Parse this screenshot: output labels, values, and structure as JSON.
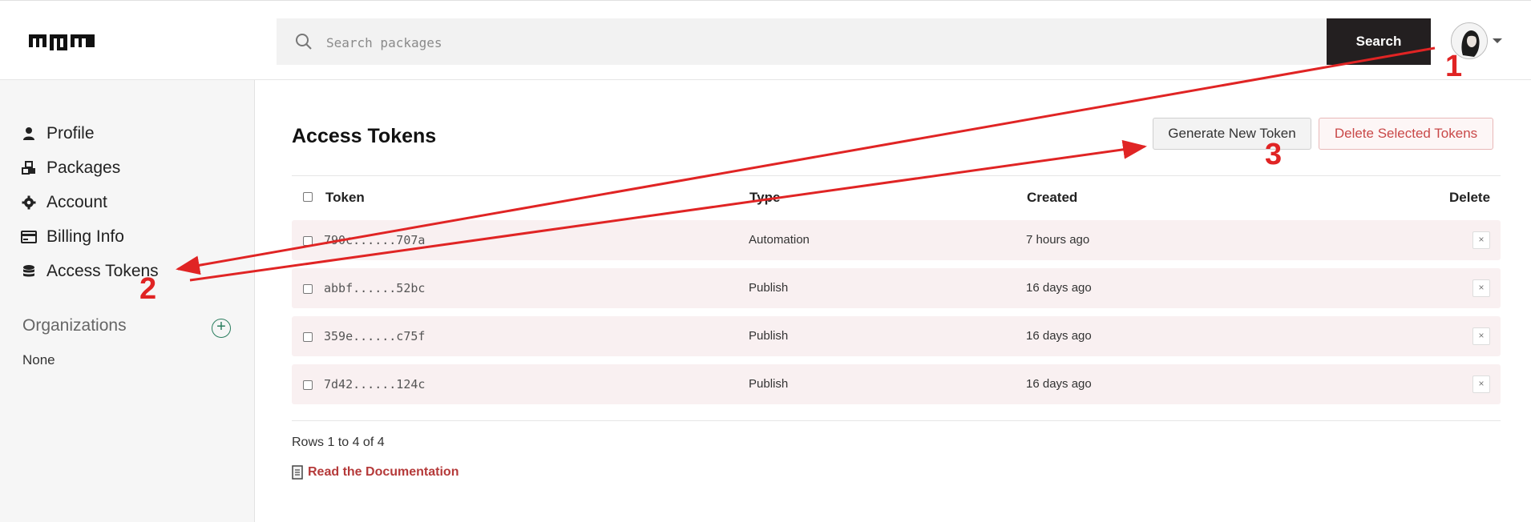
{
  "header": {
    "search_placeholder": "Search packages",
    "search_button": "Search"
  },
  "sidebar": {
    "items": [
      {
        "label": "Profile",
        "icon": "user-icon"
      },
      {
        "label": "Packages",
        "icon": "packages-icon"
      },
      {
        "label": "Account",
        "icon": "gear-icon"
      },
      {
        "label": "Billing Info",
        "icon": "credit-card-icon"
      },
      {
        "label": "Access Tokens",
        "icon": "coins-icon"
      }
    ],
    "organizations_title": "Organizations",
    "organizations_add": "+",
    "organizations_value": "None"
  },
  "main": {
    "title": "Access Tokens",
    "generate_button": "Generate New Token",
    "delete_selected_button": "Delete Selected Tokens",
    "columns": [
      "Token",
      "Type",
      "Created",
      "Delete"
    ],
    "rows": [
      {
        "token": "790c......707a",
        "type": "Automation",
        "created": "7 hours ago",
        "delete": "×"
      },
      {
        "token": "abbf......52bc",
        "type": "Publish",
        "created": "16 days ago",
        "delete": "×"
      },
      {
        "token": "359e......c75f",
        "type": "Publish",
        "created": "16 days ago",
        "delete": "×"
      },
      {
        "token": "7d42......124c",
        "type": "Publish",
        "created": "16 days ago",
        "delete": "×"
      }
    ],
    "rows_info": "Rows 1 to 4 of 4",
    "doc_link": "Read the Documentation"
  },
  "annotations": {
    "labels": [
      "1",
      "2",
      "3"
    ],
    "color": "#e02424"
  }
}
